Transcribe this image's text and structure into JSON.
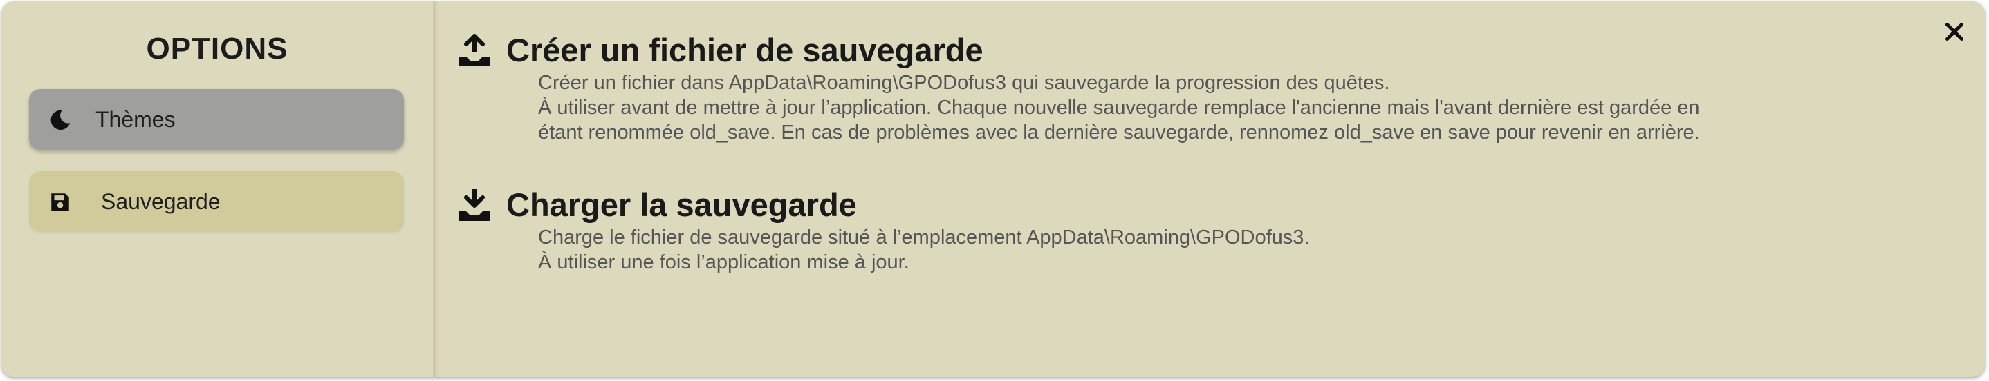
{
  "sidebar": {
    "title": "OPTIONS",
    "items": [
      {
        "label": "Thèmes",
        "icon": "moon-icon",
        "active": true
      },
      {
        "label": "Sauvegarde",
        "icon": "floppy-disk-icon",
        "active": false
      }
    ]
  },
  "close": {
    "icon": "close-icon",
    "glyph": "✕"
  },
  "sections": [
    {
      "icon": "upload-icon",
      "title": "Créer un fichier de sauvegarde",
      "lines": [
        "Créer un fichier dans AppData\\Roaming\\GPODofus3 qui sauvegarde la progression des quêtes.",
        "À utiliser avant de mettre à jour l’application. Chaque nouvelle sauvegarde remplace l'ancienne mais l'avant dernière est gardée en",
        "étant renommée old_save. En cas de problèmes avec la dernière sauvegarde, rennomez old_save en save pour revenir en arrière."
      ]
    },
    {
      "icon": "download-icon",
      "title": "Charger la sauvegarde",
      "lines": [
        "Charge le fichier de sauvegarde situé à l’emplacement AppData\\Roaming\\GPODofus3.",
        "À utiliser une fois l’application mise à jour."
      ]
    }
  ],
  "colors": {
    "background": "#ddd9bd",
    "active_item": "#9fa09d",
    "item": "#d1cb9c",
    "text_dark": "#1a1a1a",
    "text_muted": "#555555"
  }
}
